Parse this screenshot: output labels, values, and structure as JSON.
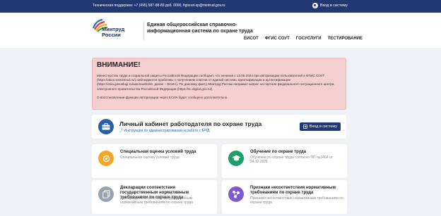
{
  "topbar": {
    "support": "Техническая поддержка: +7 (495) 587-88-89 доб. 0000, figisout-sp@mintrud.gov.ru",
    "login": "Вход в систему"
  },
  "header": {
    "brand": [
      "Минтруд",
      "России"
    ],
    "title": "Единая общероссийская справочно-информационная система по охране труда",
    "nav": [
      "ЕИСОТ",
      "ФГИС СОУТ",
      "ГОСУСЛУГИ",
      "ТЕСТИРОВАНИЕ"
    ]
  },
  "alert": {
    "title": "ВНИМАНИЕ!",
    "body": "Министерство труда и социальной защиты Российской Федерации сообщает, что начиная с 13.05.2024 при авторизации пользователей в ФГИС СОУТ (https://akot.rosmintrud.ru/) наблюдаются проблемы с получением ответов от единой системы идентификации и аутентификации (https://esia.gosuslugi.ru/aas/oauth2/te, далее – ЕСИА). По данному факту Минтруд России направил запрос на портале федерального ситуационного центра электронного правительства Российской Федерации (https://sc.digital.gov.ru/).",
    "footer": "О восстановлении функции авторизации через ЕСИА будет сообщено дополнительно."
  },
  "employer": {
    "title": "Личный кабинет работодателя по охране труда",
    "link": "Инструкция по администрированию и работе с МЧД",
    "button": "Вход в систему"
  },
  "cards": [
    {
      "title": "Специальная оценка условий труда",
      "desc": "Специальная оценка условий труда"
    },
    {
      "title": "Обучение по охране труда",
      "desc": "Обучение по охране труда согласно ПП №2464 от 24.12.2021"
    },
    {
      "title": "Декларации соответствия государственным нормативным требованиям по охране труда",
      "desc": "Декларации соответствия государственным нормативным требованиям по охране труда"
    },
    {
      "title": "Признаки несоответствия нормативным требованиям по охране труда",
      "desc": "Признаки несоответствия нормативным требованиям по охране труда"
    }
  ]
}
